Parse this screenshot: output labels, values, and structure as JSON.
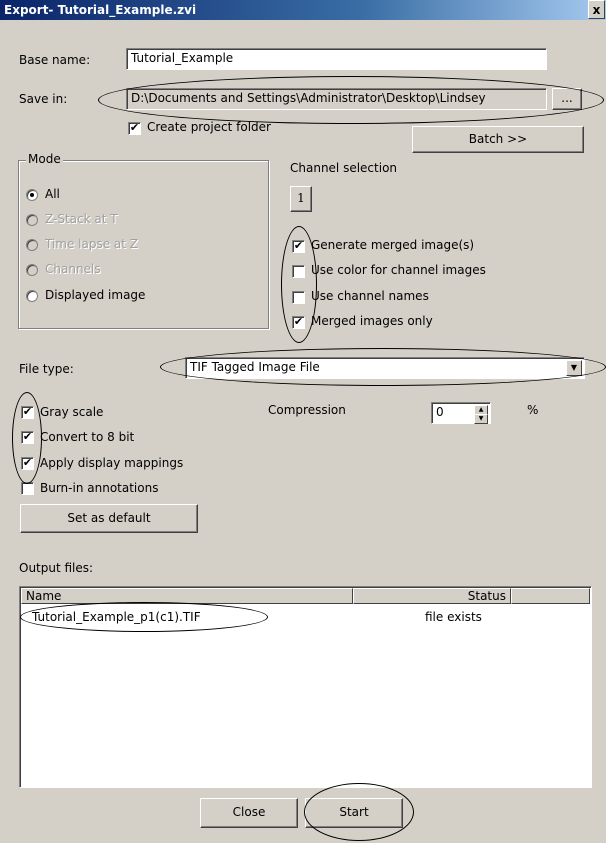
{
  "window": {
    "title": "Export- Tutorial_Example.zvi",
    "close_glyph": "x"
  },
  "base_name": {
    "label": "Base name:",
    "value": "Tutorial_Example"
  },
  "save_in": {
    "label": "Save in:",
    "value": "D:\\Documents and Settings\\Administrator\\Desktop\\Lindsey",
    "browse_label": "..."
  },
  "create_project_folder": {
    "label": "Create project folder",
    "checked": true
  },
  "batch_button": "Batch >>",
  "mode": {
    "title": "Mode",
    "options": [
      {
        "label": "All",
        "selected": true,
        "enabled": true
      },
      {
        "label": "Z-Stack at T",
        "selected": false,
        "enabled": false
      },
      {
        "label": "Time lapse at Z",
        "selected": false,
        "enabled": false
      },
      {
        "label": "Channels",
        "selected": false,
        "enabled": false
      },
      {
        "label": "Displayed image",
        "selected": false,
        "enabled": true
      }
    ]
  },
  "channel_selection": {
    "label": "Channel selection",
    "channel_button": "1"
  },
  "channel_options": [
    {
      "label": "Generate merged image(s)",
      "checked": true
    },
    {
      "label": "Use color for channel images",
      "checked": false
    },
    {
      "label": "Use channel names",
      "checked": false
    },
    {
      "label": "Merged images only",
      "checked": true
    }
  ],
  "file_type": {
    "label": "File type:",
    "value": "TIF  Tagged Image File"
  },
  "image_options": [
    {
      "label": "Gray scale",
      "checked": true
    },
    {
      "label": "Convert to 8 bit",
      "checked": true
    },
    {
      "label": "Apply display mappings",
      "checked": true
    },
    {
      "label": "Burn-in annotations",
      "checked": false
    }
  ],
  "compression": {
    "label": "Compression",
    "value": "0",
    "unit": "%"
  },
  "set_default_button": "Set as default",
  "output_files": {
    "label": "Output files:",
    "columns": [
      "Name",
      "Status"
    ],
    "rows": [
      {
        "name": "Tutorial_Example_p1(c1).TIF",
        "status": "file exists"
      }
    ]
  },
  "footer": {
    "close_button": "Close",
    "start_button": "Start"
  },
  "checkmark_glyph": "✔",
  "colors": {
    "title_bar": "#0a246a",
    "dialog_bg": "#d4d0c8"
  }
}
